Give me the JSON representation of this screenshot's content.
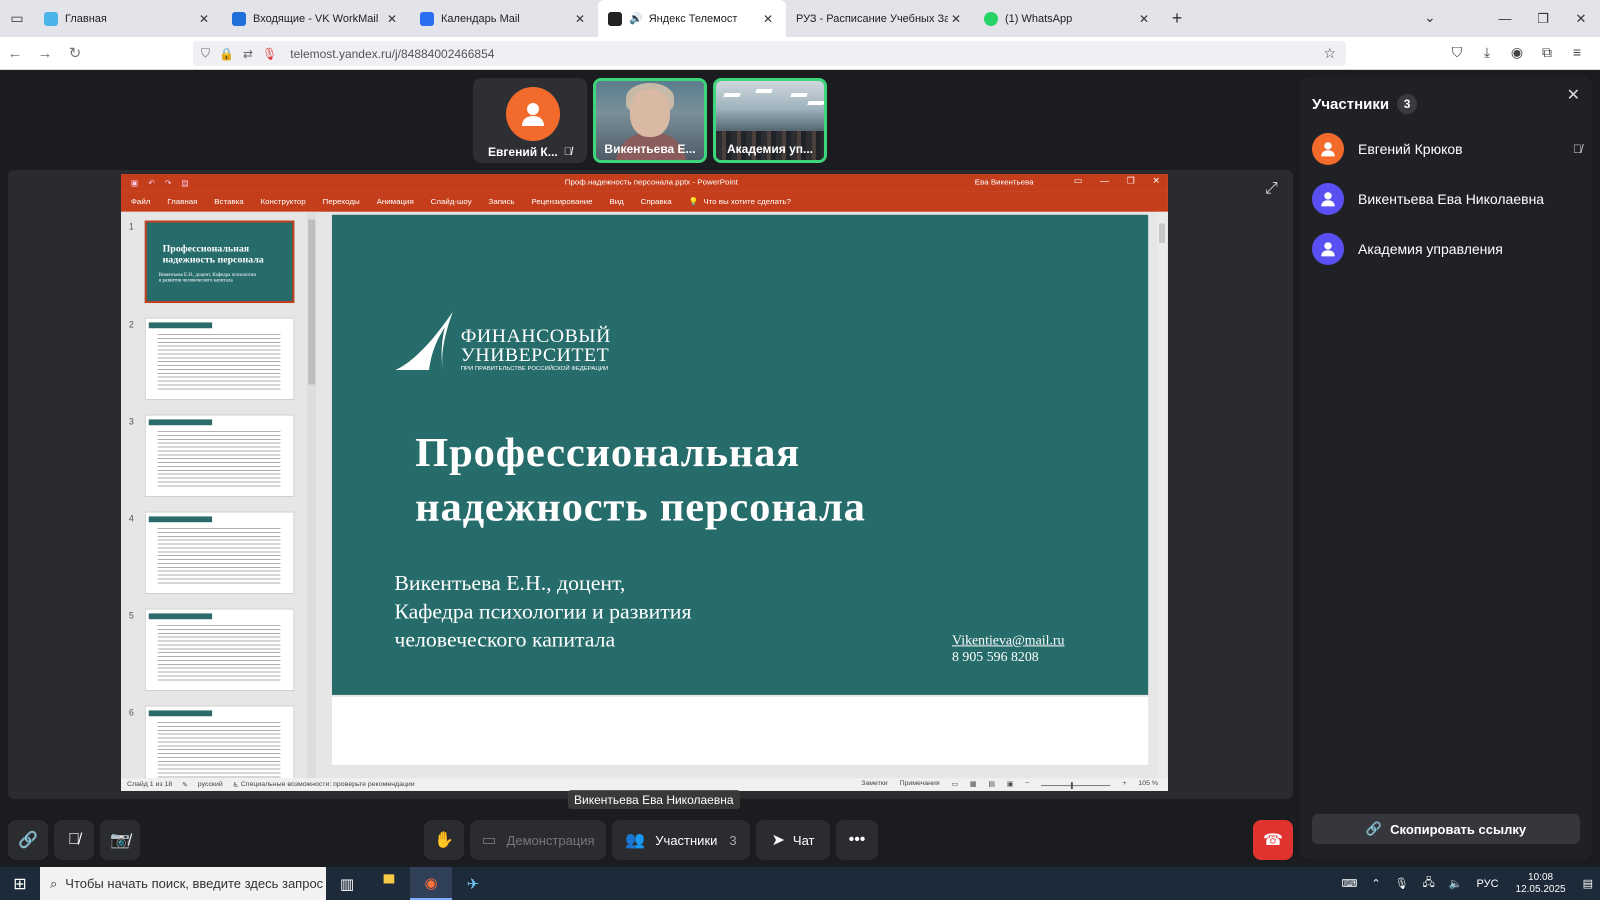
{
  "browser": {
    "tabs": [
      {
        "label": "Главная",
        "color": "#4ab3e8"
      },
      {
        "label": "Входящие - VK WorkMail",
        "color": "#1e6fd9"
      },
      {
        "label": "Календарь Mail",
        "color": "#2a6ef0"
      },
      {
        "label": "Яндекс Телемост",
        "color": "#222222",
        "active": true
      },
      {
        "label": "РУЗ - Расписание Учебных Занятий",
        "color": "#ffffff"
      },
      {
        "label": "(1) WhatsApp",
        "color": "#25d366"
      }
    ],
    "url": "telemost.yandex.ru/j/84884002466854"
  },
  "tiles": [
    {
      "name": "Евгений К...",
      "muted": true
    },
    {
      "name": "Викентьева Е..."
    },
    {
      "name": "Академия уп..."
    }
  ],
  "powerpoint": {
    "doc_title": "Проф.надежность персонала.pptx - PowerPoint",
    "user": "Ева Викентьева",
    "ribbon": [
      "Файл",
      "Главная",
      "Вставка",
      "Конструктор",
      "Переходы",
      "Анимация",
      "Слайд-шоу",
      "Запись",
      "Рецензирование",
      "Вид",
      "Справка",
      "Что вы хотите сделать?"
    ],
    "slide_numbers": [
      "1",
      "2",
      "3",
      "4",
      "5",
      "6"
    ],
    "thumb1_title": "Профессиональная надежность персонала",
    "thumb1_sub": "Викентьева Е.Н., доцент, Кафедра психологии и развития человеческого капитала",
    "slide": {
      "logo_line1": "ФИНАНСОВЫЙ",
      "logo_line2": "УНИВЕРСИТЕТ",
      "logo_sub": "ПРИ ПРАВИТЕЛЬСТВЕ РОССИЙСКОЙ ФЕДЕРАЦИИ",
      "title_line1": "Профессиональная",
      "title_line2": "надежность персонала",
      "author_line1": "Викентьева Е.Н., доцент,",
      "author_line2": "Кафедра психологии и развития",
      "author_line3": "человеческого капитала",
      "email": "Vikentieva@mail.ru",
      "phone": "8 905 596 8208"
    },
    "status": {
      "slide_of": "Слайд 1 из 18",
      "lang": "русский",
      "accessibility": "Специальные возможности: проверьте рекомендации",
      "notes": "Заметки",
      "comments": "Примечания",
      "zoom": "105 %"
    }
  },
  "speaker_label": "Викентьева Ева Николаевна",
  "participants": {
    "title": "Участники",
    "count": "3",
    "list": [
      {
        "name": "Евгений Крюков",
        "color": "#f26b2d",
        "muted": true
      },
      {
        "name": "Викентьева Ева Николаевна",
        "color": "#5a4ff2"
      },
      {
        "name": "Академия управления",
        "color": "#5a4ff2"
      }
    ],
    "copy_link": "Скопировать ссылку"
  },
  "controls": {
    "demo": "Демонстрация",
    "participants": "Участники",
    "participants_count": "3",
    "chat": "Чат"
  },
  "taskbar": {
    "search_placeholder": "Чтобы начать поиск, введите здесь запрос",
    "lang": "РУС",
    "time": "10:08",
    "date": "12.05.2025"
  }
}
